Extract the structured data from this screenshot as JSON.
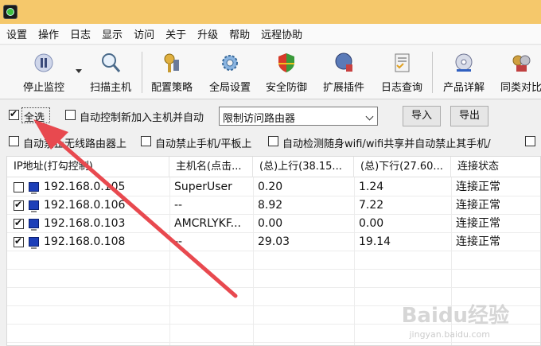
{
  "menu": [
    "设置",
    "操作",
    "日志",
    "显示",
    "访问",
    "关于",
    "升级",
    "帮助",
    "远程协助"
  ],
  "toolbar": [
    {
      "label": "停止监控",
      "icon": "pause-icon"
    },
    {
      "label": "扫描主机",
      "icon": "magnifier-icon"
    },
    {
      "label": "配置策略",
      "icon": "keys-icon"
    },
    {
      "label": "全局设置",
      "icon": "gear-icon"
    },
    {
      "label": "安全防御",
      "icon": "shield-icon"
    },
    {
      "label": "扩展插件",
      "icon": "plugin-icon"
    },
    {
      "label": "日志查询",
      "icon": "log-book-icon"
    },
    {
      "label": "产品详解",
      "icon": "disc-icon"
    },
    {
      "label": "同类对比",
      "icon": "medal-icon"
    }
  ],
  "controls": {
    "select_all": "全选",
    "auto_control": "自动控制新加入主机并自动",
    "policy_value": "限制访问路由器",
    "import": "导入",
    "export": "导出",
    "row2": [
      "自动禁止无线路由器上",
      "自动禁止手机/平板上",
      "自动检测随身wifi/wifi共享并自动禁止其手机/"
    ]
  },
  "table": {
    "headers": [
      "IP地址(打勾控制)",
      "主机名(点击...",
      "(总)上行(38.15...",
      "(总)下行(27.60...",
      "连接状态"
    ],
    "rows": [
      {
        "checked": false,
        "ip": "192.168.0.105",
        "host": "SuperUser",
        "up": "0.20",
        "down": "1.24",
        "status": "连接正常"
      },
      {
        "checked": true,
        "ip": "192.168.0.106",
        "host": "--",
        "up": "8.92",
        "down": "7.22",
        "status": "连接正常"
      },
      {
        "checked": true,
        "ip": "192.168.0.103",
        "host": "AMCRLYKF...",
        "up": "0.00",
        "down": "0.00",
        "status": "连接正常"
      },
      {
        "checked": true,
        "ip": "192.168.0.108",
        "host": "--",
        "up": "29.03",
        "down": "19.14",
        "status": "连接正常"
      }
    ]
  },
  "watermark": {
    "main": "Baidu经验",
    "sub": "jingyan.baidu.com"
  },
  "colors": {
    "titlebar": "#f5c86b",
    "arrow": "#e8494f"
  }
}
